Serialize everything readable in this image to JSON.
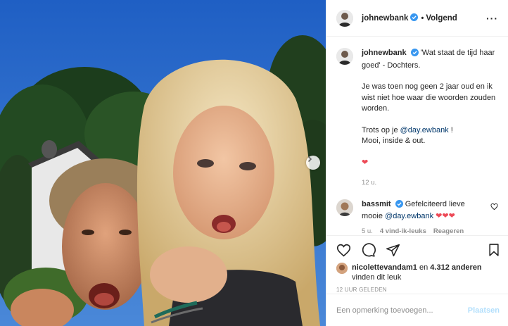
{
  "header": {
    "username": "johnewbank",
    "separator": "•",
    "follow_label": "Volgend",
    "more_label": "···"
  },
  "caption": {
    "username": "johnewbank",
    "text_line1": "'Wat staat de tijd haar goed' - Dochters.",
    "paragraph2": "Je was toen nog geen 2 jaar oud en ik wist niet hoe waar die woorden zouden worden.",
    "p3_prefix": "Trots op je ",
    "p3_mention": "@day.ewbank",
    "p3_suffix": " !",
    "p3_line2": "Mooi, inside & out.",
    "hearts": "❤",
    "time": "12 u."
  },
  "comment": {
    "username": "bassmit",
    "text_prefix": "Gefelciteerd lieve mooie ",
    "mention": "@day.ewbank",
    "hearts": "❤❤❤",
    "time": "5 u.",
    "likes": "4 vind-ik-leuks",
    "reply": "Reageren"
  },
  "likes": {
    "user": "nicolettevandam1",
    "connector": " en ",
    "count": "4.312 anderen",
    "suffix": "vinden dit leuk"
  },
  "timestamp": "12 UUR GELEDEN",
  "add_comment": {
    "placeholder": "Een opmerking toevoegen...",
    "post_label": "Plaatsen"
  },
  "colors": {
    "verified": "#3897f0",
    "heart": "#ed4956",
    "mention": "#00376b",
    "post_button": "#b2dffc"
  },
  "icons": [
    "chevron-right-icon",
    "heart-icon",
    "comment-icon",
    "share-icon",
    "bookmark-icon",
    "verified-icon",
    "more-icon"
  ]
}
